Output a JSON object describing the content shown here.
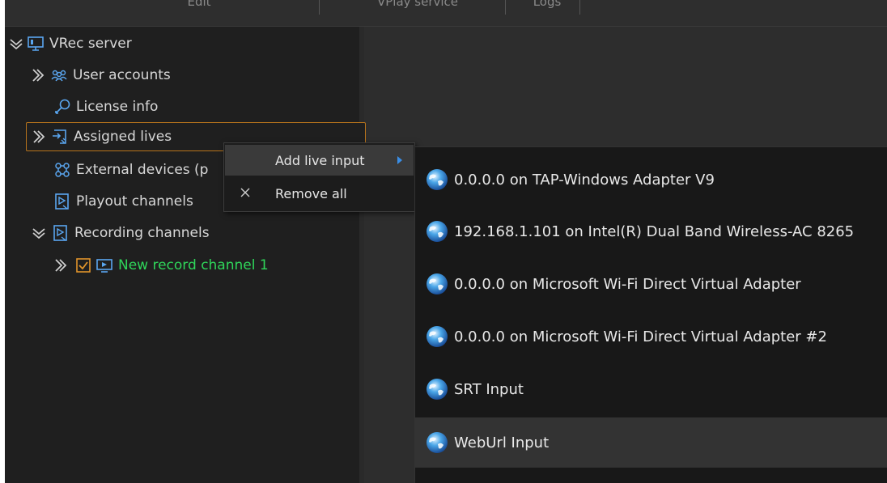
{
  "topbar": {
    "tabs": [
      "Edit",
      "VPlay service",
      "Logs"
    ]
  },
  "tree": {
    "root_label": "VRec server",
    "items": [
      {
        "label": "User accounts",
        "icon": "users-icon"
      },
      {
        "label": "License info",
        "icon": "key-icon"
      },
      {
        "label": "Assigned lives",
        "icon": "assigned-lives-icon",
        "selected": true
      },
      {
        "label": "External devices (p",
        "icon": "external-devices-icon"
      },
      {
        "label": "Playout channels",
        "icon": "playout-channels-icon"
      },
      {
        "label": "Recording channels",
        "icon": "recording-channels-icon"
      }
    ],
    "record_channel": {
      "label": "New record channel 1",
      "checked": true,
      "color": "#2fd65a"
    }
  },
  "context_menu": {
    "add_live_input": "Add live input",
    "remove_all": "Remove all"
  },
  "submenu": {
    "items": [
      "0.0.0.0 on TAP-Windows Adapter V9",
      "192.168.1.101 on Intel(R) Dual Band Wireless-AC 8265",
      "0.0.0.0 on Microsoft Wi-Fi Direct Virtual Adapter",
      "0.0.0.0 on Microsoft Wi-Fi Direct Virtual Adapter #2",
      "SRT Input",
      "WebUrl Input"
    ],
    "highlighted_index": 5
  },
  "colors": {
    "accent_orange": "#b8741c",
    "accent_blue": "#3a8ee6",
    "record_green": "#2fd65a"
  }
}
